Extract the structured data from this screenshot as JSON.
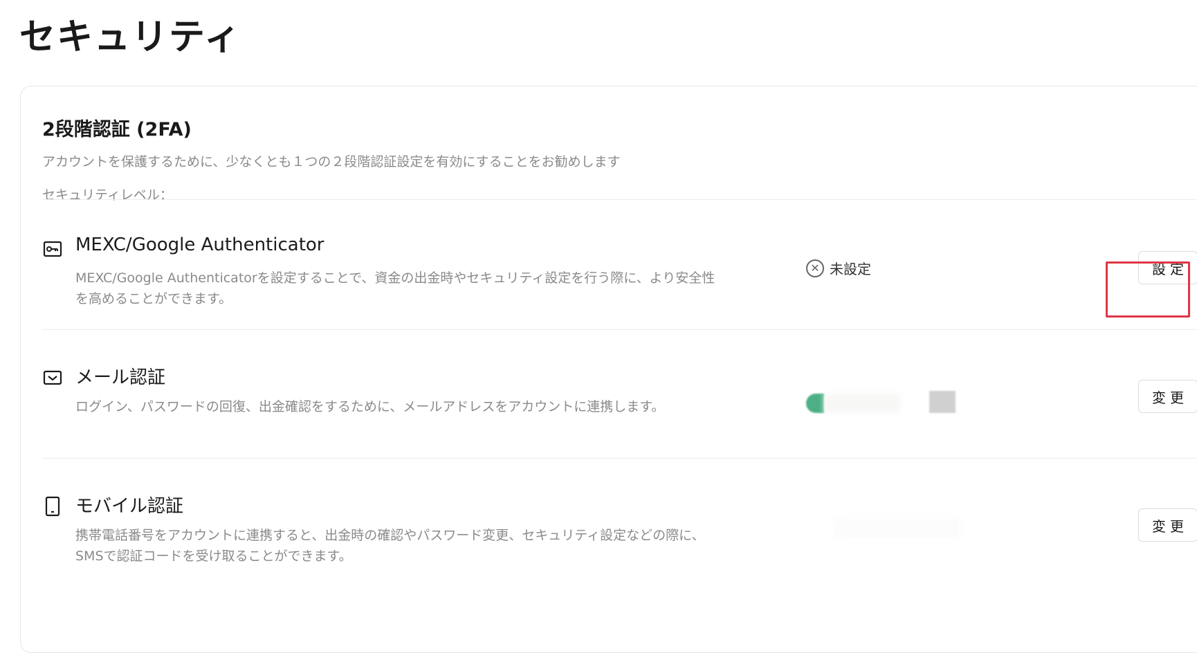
{
  "page": {
    "title": "セキュリティ"
  },
  "twofa": {
    "title": "2段階認証 (2FA)",
    "description": "アカウントを保護するために、少なくとも１つの２段階認証設定を有効にすることをお勧めします",
    "level_label": "セキュリティレベル：",
    "level_value": ""
  },
  "items": [
    {
      "icon": "key-icon",
      "name": "MEXC/Google Authenticator",
      "description": "MEXC/Google Authenticatorを設定することで、資金の出金時やセキュリティ設定を行う際に、より安全性を高めることができます。",
      "status": "未設定",
      "action_label": "設定"
    },
    {
      "icon": "mail-icon",
      "name": "メール認証",
      "description": "ログイン、パスワードの回復、出金確認をするために、メールアドレスをアカウントに連携します。",
      "status": "",
      "action_label": "変更"
    },
    {
      "icon": "mobile-icon",
      "name": "モバイル認証",
      "description": "携帯電話番号をアカウントに連携すると、出金時の確認やパスワード変更、セキュリティ設定などの際に、SMSで認証コードを受け取ることができます。",
      "status": "",
      "action_label": "変更"
    }
  ],
  "colors": {
    "highlight": "#e03545",
    "status_green": "#4caf85"
  }
}
